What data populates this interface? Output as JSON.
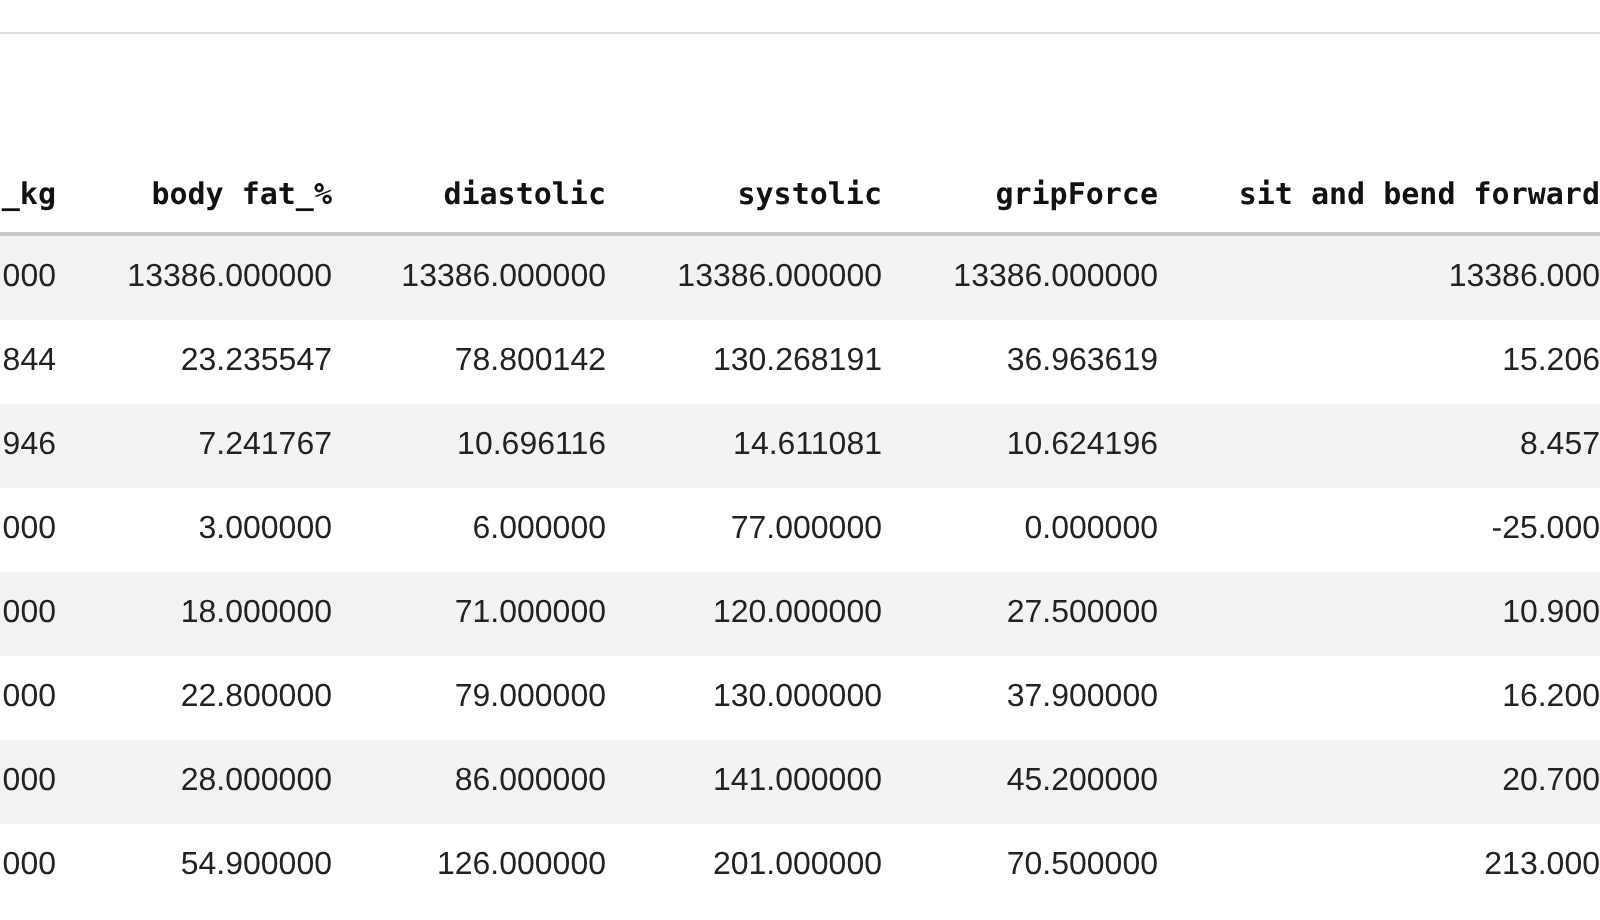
{
  "table": {
    "columns": [
      "_kg",
      "body fat_%",
      "diastolic",
      "systolic",
      "gripForce",
      "sit and bend forward"
    ],
    "rows": [
      [
        "000",
        "13386.000000",
        "13386.000000",
        "13386.000000",
        "13386.000000",
        "13386.000"
      ],
      [
        "844",
        "23.235547",
        "78.800142",
        "130.268191",
        "36.963619",
        "15.206"
      ],
      [
        "946",
        "7.241767",
        "10.696116",
        "14.611081",
        "10.624196",
        "8.457"
      ],
      [
        "000",
        "3.000000",
        "6.000000",
        "77.000000",
        "0.000000",
        "-25.000"
      ],
      [
        "000",
        "18.000000",
        "71.000000",
        "120.000000",
        "27.500000",
        "10.900"
      ],
      [
        "000",
        "22.800000",
        "79.000000",
        "130.000000",
        "37.900000",
        "16.200"
      ],
      [
        "000",
        "28.000000",
        "86.000000",
        "141.000000",
        "45.200000",
        "20.700"
      ],
      [
        "000",
        "54.900000",
        "126.000000",
        "201.000000",
        "70.500000",
        "213.000"
      ]
    ]
  }
}
